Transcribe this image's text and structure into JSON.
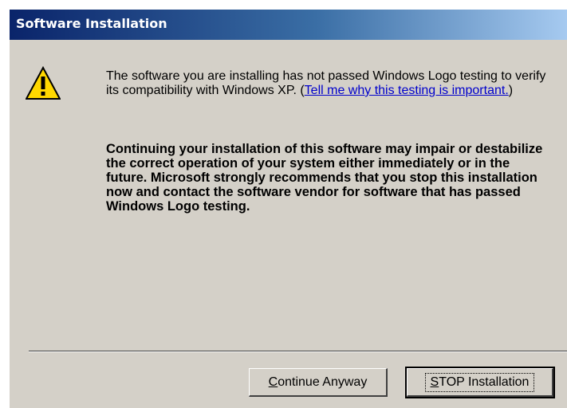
{
  "window": {
    "title": "Software Installation"
  },
  "icons": {
    "warning": "warning-icon",
    "warning_fill": "#ffd800"
  },
  "message": {
    "line_normal_pre_link": "The software you are installing has not passed Windows Logo testing to verify its compatibility with Windows XP. (",
    "link_text": "Tell me why this testing is important.",
    "line_normal_post_link": ")",
    "bold_text": "Continuing your installation of this software may impair or destabilize the correct operation of your system either immediately or in the future. Microsoft strongly recommends that you stop this installation now and contact the software vendor for software that has passed Windows Logo testing."
  },
  "buttons": {
    "continue": {
      "mnemonic": "C",
      "rest": "ontinue Anyway"
    },
    "stop": {
      "mnemonic": "S",
      "rest": "TOP Installation"
    }
  },
  "colors": {
    "titlebar_start": "#0a246a",
    "titlebar_end": "#a6caf0",
    "dialog_bg": "#d4d0c8",
    "link": "#0000cc"
  }
}
